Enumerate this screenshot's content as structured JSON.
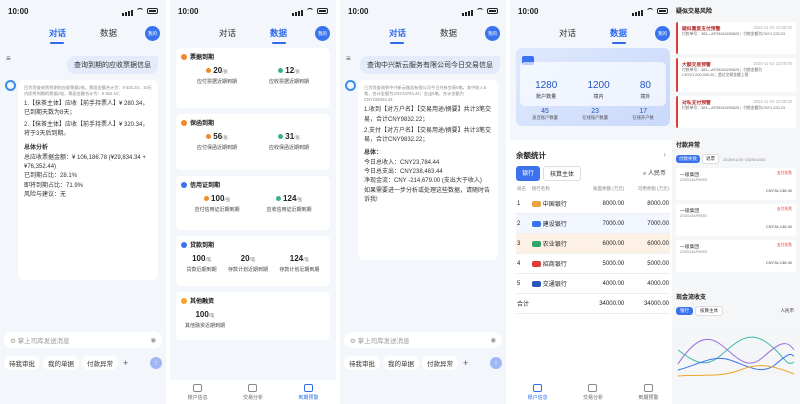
{
  "status_time": "10:00",
  "tabs": [
    "对话",
    "数据"
  ],
  "avatar_label": "我的",
  "p1": {
    "user_msg": "查询到期的应收票据信息",
    "intro": "目为您查询到到期的应收票据2张。票面金额合计为：¥ 834.34；10天内即将到期的票据2张，票面金额合计为：¥ 352.44；",
    "item1": "1.【抹茶主体】应收【前手持票人】¥ 280.34，",
    "item1b": "已到期天数为8天；",
    "item2": "2.【抹茶主体】应收【前手持票人】¥ 320.34，",
    "item2b": "将于3天后到期。",
    "total_title": "总体分析",
    "total_amt": "总应收票据金额：¥ 106,186.78 (¥29,834.34 + ¥76,352.44)",
    "due_ratio": "已到期占比：28.1%",
    "near_ratio": "即将到期占比：71.9%",
    "risk": "风险与建议：无"
  },
  "composer_placeholder": "掌上司库发送消息",
  "quick_buttons": [
    "待我审批",
    "我的单据",
    "付款异常"
  ],
  "plus": "+",
  "send_glyph": "↑",
  "p2": {
    "sections": [
      {
        "title": "票据到期",
        "color": "#f08a2a",
        "kpis": [
          {
            "num": "20",
            "unit": "/张",
            "label": "应付票据近期到期",
            "color": "#f08a2a"
          },
          {
            "num": "12",
            "unit": "/张",
            "label": "应收票据近期到期",
            "color": "#3bb18b"
          }
        ]
      },
      {
        "title": "保函到期",
        "color": "#f08a2a",
        "kpis": [
          {
            "num": "56",
            "unit": "/张",
            "label": "应付保函近期到期",
            "color": "#f08a2a"
          },
          {
            "num": "31",
            "unit": "/张",
            "label": "应收保函近期到期",
            "color": "#3bb18b"
          }
        ]
      },
      {
        "title": "信用证到期",
        "color": "#3b73ee",
        "kpis": [
          {
            "num": "100",
            "unit": "/张",
            "label": "应付信用证近期到期",
            "color": "#f08a2a"
          },
          {
            "num": "124",
            "unit": "/张",
            "label": "应收信用证近期到期",
            "color": "#3bb18b"
          }
        ]
      },
      {
        "title": "贷款到期",
        "color": "#3b73ee",
        "kpis3": [
          {
            "num": "100",
            "unit": "/笔",
            "label": "贷款近期到期"
          },
          {
            "num": "20",
            "unit": "/笔",
            "label": "存款计划近期到期"
          },
          {
            "num": "124",
            "unit": "/笔",
            "label": "存款计划近期到期"
          }
        ]
      },
      {
        "title": "其他融资",
        "color": "#f0a52a",
        "kpis1": {
          "num": "100",
          "unit": "/笔",
          "label": "其他融资近期到期"
        }
      }
    ],
    "nav": [
      "账户信息",
      "交易分析",
      "到期预警"
    ]
  },
  "p3": {
    "user_msg": "查询中兴新云服务有限公司今日交易信息",
    "intro": "已为您查询到中兴新云服务有限公司今日共有交易5笔，其中收入5笔，合计金额为CNY23784.44；支出5笔，合计金额为CNY238463.44",
    "l1": "1.收到【对方户名】【交易用途/摘要】共计3笔交易，合计CNY9832.22；",
    "l2": "2.支付【对方户名】【交易用途/摘要】共计3笔交易，合计CNY9832.22；",
    "total_title": "总体：",
    "in": "今日总收入：CNY23,784.44",
    "out": "今日总支出：CNY238,463.44",
    "net": "净现金流：CNY -214,679.00 (支出大于收入)",
    "tip": "如果需要进一步分析或处理这些数据，请随时告诉我!"
  },
  "p4": {
    "banner_main": [
      {
        "num": "1280",
        "label": "账户数量"
      },
      {
        "num": "1200",
        "label": "境内"
      },
      {
        "num": "80",
        "label": "境外"
      }
    ],
    "banner_sub": [
      {
        "num": "45",
        "label": "直连账户数量"
      },
      {
        "num": "23",
        "label": "在线账户数量"
      },
      {
        "num": "17",
        "label": "在线开户数"
      }
    ],
    "balance_title": "余额统计",
    "balance_tabs": [
      "银行",
      "核算主体"
    ],
    "currency_hint": "人民币",
    "headers": [
      "排名",
      "银行名称",
      "账面余额 (万元)",
      "可用余额 (万元)"
    ],
    "rows": [
      {
        "rank": "1",
        "bank": "中国银行",
        "book": "8000.00",
        "avail": "8000.00",
        "color": "#e8a442"
      },
      {
        "rank": "2",
        "bank": "建设银行",
        "book": "7000.00",
        "avail": "7000.00",
        "color": "#3b73ee"
      },
      {
        "rank": "3",
        "bank": "农业银行",
        "book": "6000.00",
        "avail": "6000.00",
        "color": "#2fa86a"
      },
      {
        "rank": "4",
        "bank": "招商银行",
        "book": "5000.00",
        "avail": "5000.00",
        "color": "#e03b3b"
      },
      {
        "rank": "5",
        "bank": "交通银行",
        "book": "4000.00",
        "avail": "4000.00",
        "color": "#2b57b8"
      }
    ],
    "sum_label": "合计",
    "sum_book": "34000.00",
    "sum_avail": "34000.00",
    "nav": [
      "账户信息",
      "交易分析",
      "到期预警"
    ]
  },
  "p5": {
    "risk_title": "疑似交易风险",
    "risks": [
      {
        "name": "疑似重复支付预警",
        "date": "2024-11-02 12:00:00",
        "l1": "付款单号：383—AP28349209825；付款金额为CNY1,233.23",
        "l2": ""
      },
      {
        "name": "大额交易预警",
        "date": "2024-11-02 12:00:00",
        "l1": "付款单号：383—AP28349209825；付款金额为CNY21,000,000.00；超过交易金额上限",
        "l2": ""
      },
      {
        "name": "对私支付预警",
        "date": "2024-11-02 12:00:00",
        "l1": "付款单号：383—AP28349209825；付款金额为CNY1,233.23",
        "l2": ""
      }
    ],
    "pay_title": "付款异常",
    "pay_tabs": [
      "付款失败",
      "退票"
    ],
    "pay_date": "2025/01/20~2025/02/20",
    "pays": [
      {
        "name": "一级集团",
        "code": "ZS0013AP8593",
        "amt": "CNY34,136.30",
        "tag": "支付失败"
      },
      {
        "name": "一级集团",
        "code": "ZS0013AP8593",
        "amt": "CNY34,136.30",
        "tag": "支付失败"
      },
      {
        "name": "一级集团",
        "code": "ZS0013AP8593",
        "amt": "CNY34,136.30",
        "tag": "支付失败"
      }
    ],
    "flow_title": "现金流收支",
    "flow_tabs": [
      "银行",
      "核算主体"
    ],
    "flow_currency": "人民币"
  }
}
